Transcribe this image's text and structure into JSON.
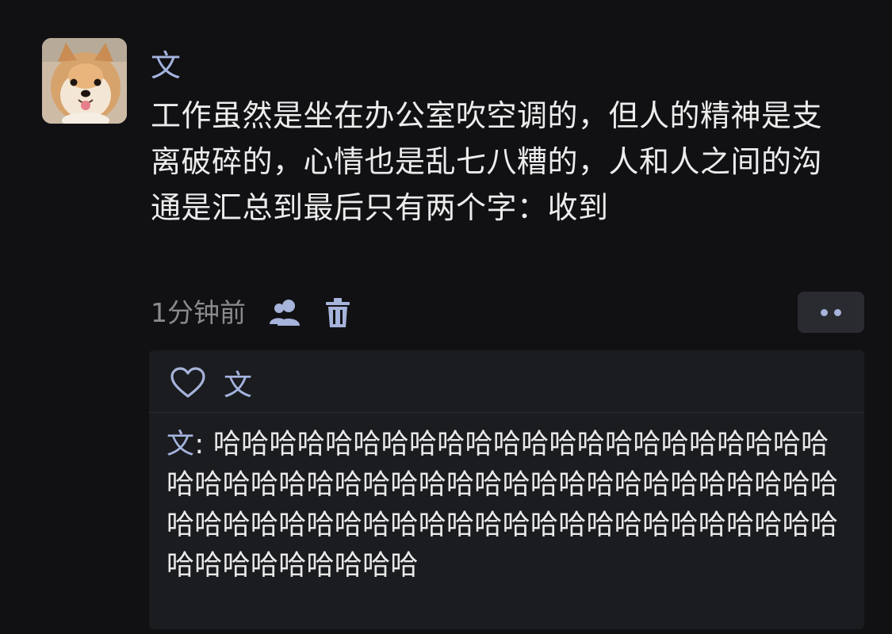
{
  "post": {
    "author": "文",
    "content": "工作虽然是坐在办公室吹空调的，但人的精神是支离破碎的，心情也是乱七八糟的，人和人之间的沟通是汇总到最后只有两个字：收到",
    "timestamp": "1分钟前",
    "avatar_icon": "shiba-dog-avatar"
  },
  "actions": {
    "user_icon": "user-icon",
    "delete_icon": "trash-icon",
    "more_icon": "more-dots-icon"
  },
  "likes": {
    "icon": "heart-icon",
    "names": "文"
  },
  "comments": [
    {
      "author": "文",
      "separator": ": ",
      "text": "哈哈哈哈哈哈哈哈哈哈哈哈哈哈哈哈哈哈哈哈哈哈哈哈哈哈哈哈哈哈哈哈哈哈哈哈哈哈哈哈哈哈哈哈哈哈哈哈哈哈哈哈哈哈哈哈哈哈哈哈哈哈哈哈哈哈哈哈哈哈哈哈哈哈哈哈哈哈哈"
    }
  ],
  "colors": {
    "background": "#111114",
    "name_accent": "#a5b4df",
    "panel": "#1b1c20",
    "muted_text": "#8a8a8f"
  }
}
